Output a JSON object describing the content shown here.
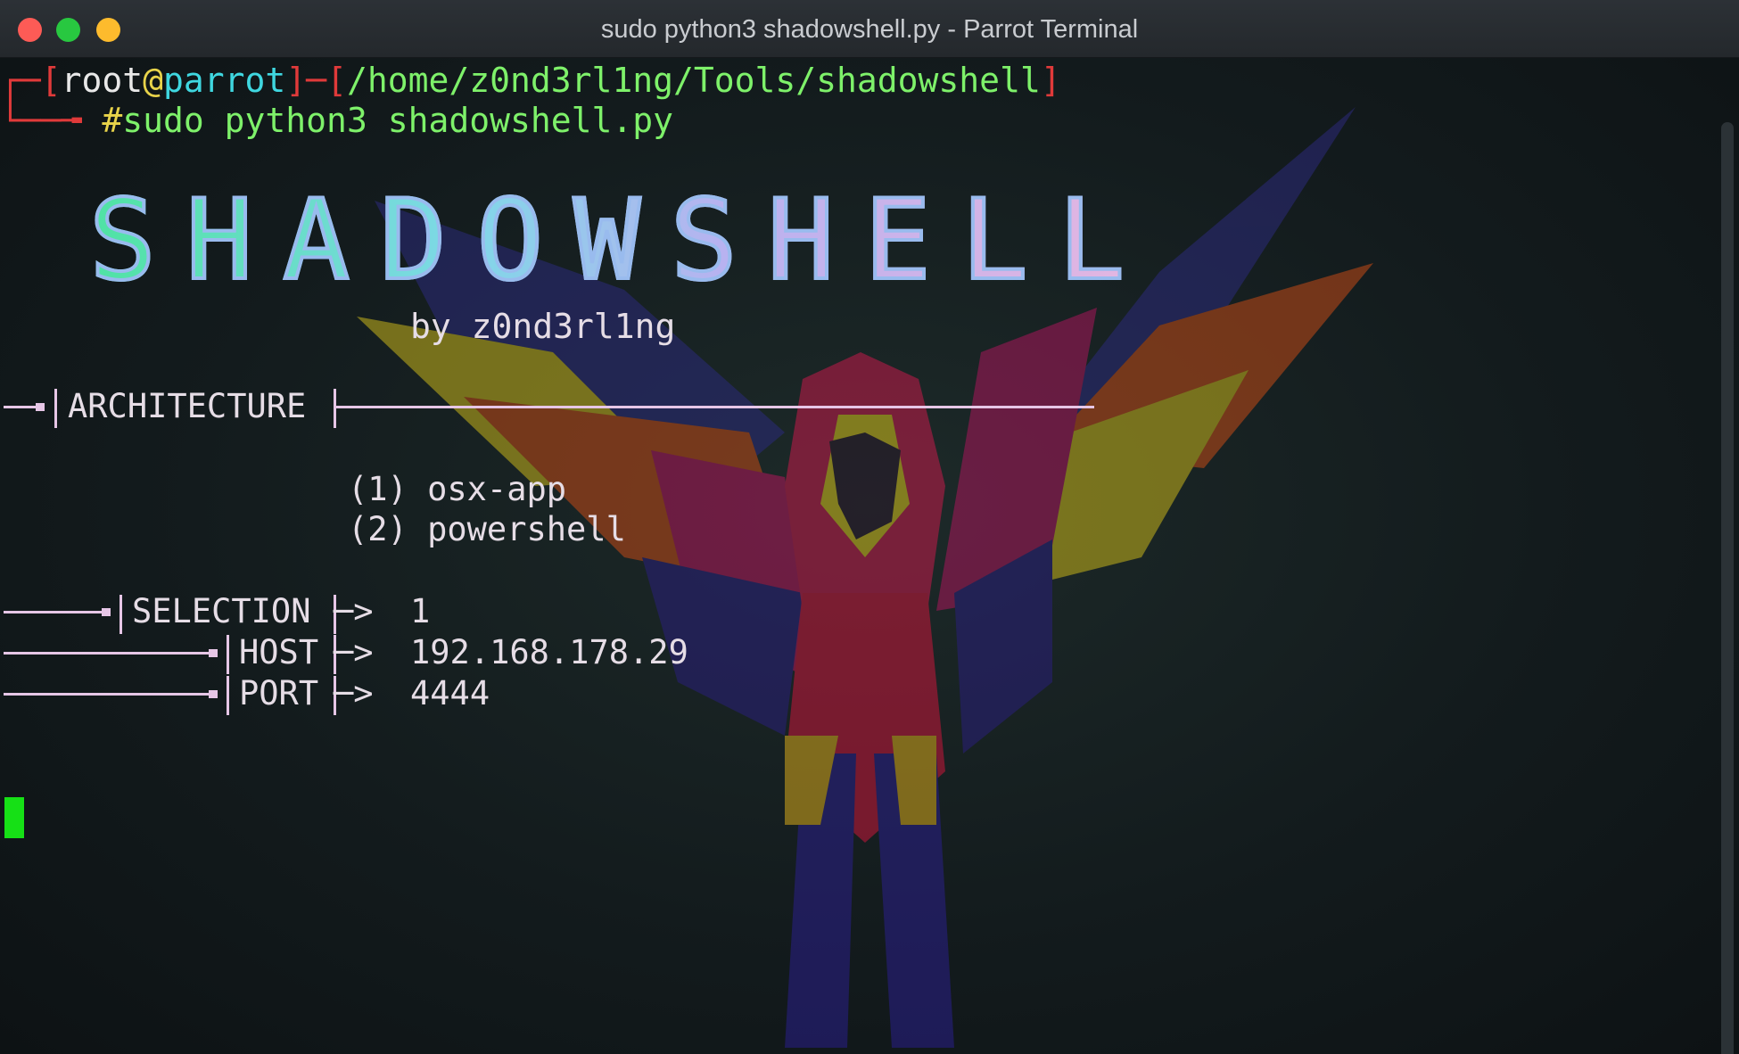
{
  "window": {
    "title": "sudo python3 shadowshell.py - Parrot Terminal",
    "buttons": [
      "close",
      "maximize",
      "minimize"
    ]
  },
  "prompt": {
    "open_bracket": "┌─[",
    "user": "root",
    "at": "@",
    "host": "parrot",
    "separator": "]─[",
    "path": "/home/z0nd3rl1ng/Tools/shadowshell",
    "close_bracket": "]",
    "continuation": "└──╼ ",
    "hash": "#",
    "command": "sudo python3 shadowshell.py"
  },
  "banner": {
    "title": "SHADOWSHELL",
    "author": "by z0nd3rl1ng"
  },
  "architecture": {
    "heading": "ARCHITECTURE",
    "options": [
      "(1) osx-app",
      "(2) powershell"
    ]
  },
  "inputs": {
    "selection_label": "SELECTION",
    "selection_value": "1",
    "host_label": "HOST",
    "host_value": "192.168.178.29",
    "port_label": "PORT",
    "port_value": "4444",
    "arrow": "─> "
  },
  "colors": {
    "prompt_bracket": "#e03a3a",
    "user": "#e8e8e8",
    "host": "#3fd7e0",
    "at": "#e8d34a",
    "path": "#7ef16a",
    "command": "#7ef16a",
    "cursor": "#16e016"
  },
  "background_icon": "parrot-logo"
}
